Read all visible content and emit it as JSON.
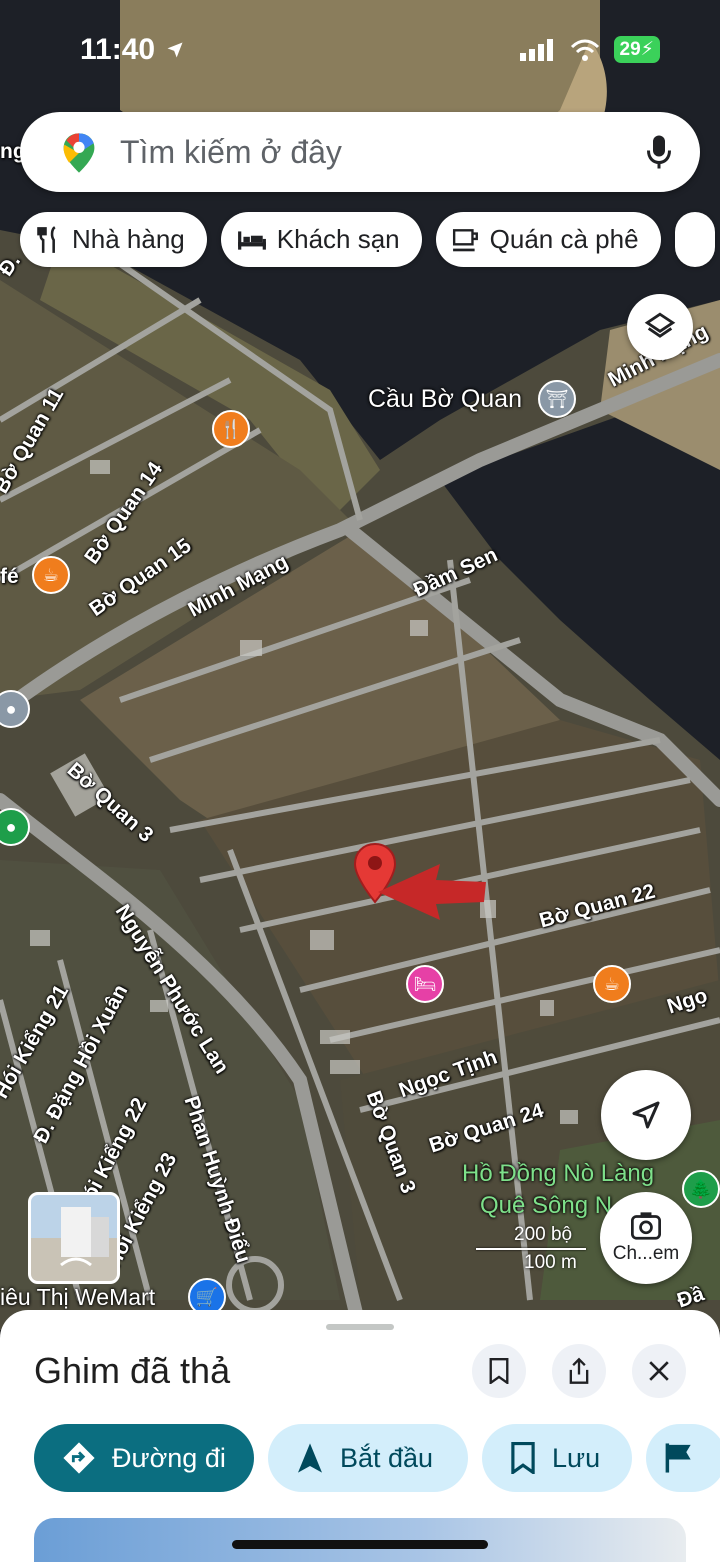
{
  "status_bar": {
    "time": "11:40",
    "battery": "29"
  },
  "search": {
    "placeholder": "Tìm kiếm ở đây"
  },
  "chips": [
    {
      "label": "Nhà hàng",
      "icon": "fork-knife-icon"
    },
    {
      "label": "Khách sạn",
      "icon": "bed-icon"
    },
    {
      "label": "Quán cà phê",
      "icon": "coffee-icon"
    }
  ],
  "map": {
    "streets": [
      "Minh Mạng",
      "Bờ Quan 14",
      "Bờ Quan 15",
      "Minh Mạng",
      "Đầm Sen",
      "Bờ Quan 3",
      "Nguyễn Phước Lan",
      "Bờ Quan 22",
      "Ngọc Tịnh",
      "Bờ Quan 24",
      "Bờ Quan 3",
      "Đ. Đặng Hồi Xuân",
      "Phan Huỳnh Điểu",
      "Hói Kiểng 21",
      "Hói Kiểng 22",
      "Hói Kiểng 23",
      "Bờ Quan 11",
      "Ngọ",
      "Bờ Quan 24",
      "Đầ",
      "Đ.",
      "ng N",
      "fé"
    ],
    "poi_bridge": "Cầu Bờ Quan",
    "park": [
      "Hồ Đồng Nò Làng",
      "Quê Sông N"
    ],
    "supermarket": "iêu Thị WeMart",
    "scale": {
      "imperial": "200 bộ",
      "metric": "100 m"
    },
    "lens_label": "Ch...em"
  },
  "sheet": {
    "title": "Ghim đã thả",
    "actions": [
      {
        "label": "Đường đi"
      },
      {
        "label": "Bắt đầu"
      },
      {
        "label": "Lưu"
      }
    ]
  },
  "colors": {
    "primary": "#0b6e80",
    "tonal": "#d3eefb",
    "pin": "#e53935",
    "arrow": "#c62828"
  }
}
